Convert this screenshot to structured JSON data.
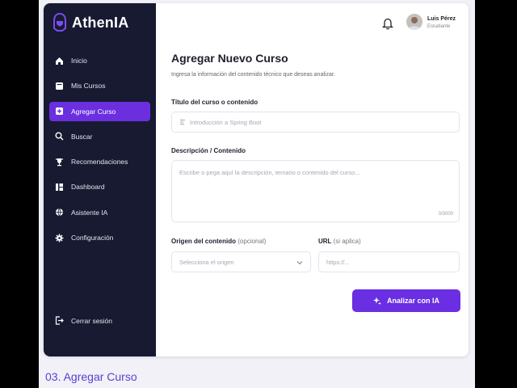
{
  "brand": {
    "name": "AthenIA"
  },
  "sidebar": {
    "items": [
      {
        "label": "Inicio",
        "icon": "home-icon"
      },
      {
        "label": "Mis Cursos",
        "icon": "book-icon"
      },
      {
        "label": "Agregar Curso",
        "icon": "add-course-icon",
        "active": true
      },
      {
        "label": "Buscar",
        "icon": "search-icon"
      },
      {
        "label": "Recomendaciones",
        "icon": "trophy-icon"
      },
      {
        "label": "Dashboard",
        "icon": "dashboard-icon"
      },
      {
        "label": "Asistente IA",
        "icon": "globe-icon"
      },
      {
        "label": "Configuración",
        "icon": "gear-icon"
      }
    ],
    "logout": "Cerrar sesión"
  },
  "user": {
    "name": "Luis Pérez",
    "role": "Estudiante"
  },
  "form": {
    "title": "Agregar Nuevo Curso",
    "subtitle": "Ingresa la información del contenido técnico que deseas analizar.",
    "course_title_label": "Título del curso o contenido",
    "course_title_placeholder": "Introducción a Spring Boot",
    "description_label": "Descripción / Contenido",
    "description_placeholder": "Escribe o pega aquí la descripción, temario o contenido del curso...",
    "description_counter": "0/3000",
    "origin_label": "Origen del contenido",
    "origin_optional": "(opcional)",
    "origin_placeholder": "Selecciona el origen",
    "url_label": "URL",
    "url_optional": "(si aplica)",
    "url_placeholder": "https://...",
    "submit_label": "Analizar con IA"
  },
  "caption": "03.  Agregar Curso",
  "colors": {
    "sidebar": "#171a31",
    "accent": "#6b2fe0",
    "caption": "#5b3fd0"
  }
}
